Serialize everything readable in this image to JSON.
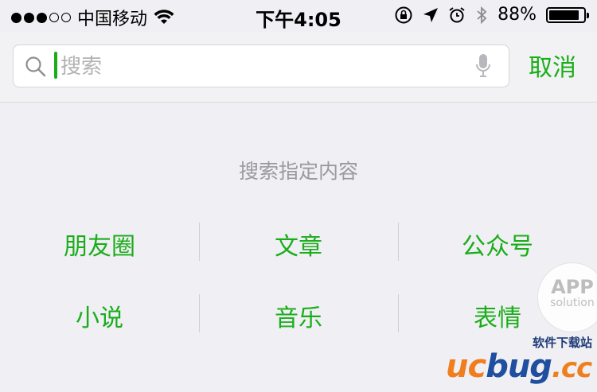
{
  "status_bar": {
    "carrier": "中国移动",
    "time": "下午4:05",
    "battery_text": "88%",
    "battery_level": 0.88,
    "signal_bars_filled": 3,
    "signal_bars_total": 5,
    "icons": [
      "wifi-icon",
      "rotation-lock-icon",
      "location-icon",
      "alarm-icon",
      "bluetooth-icon",
      "battery-icon"
    ]
  },
  "search": {
    "placeholder": "搜索",
    "value": "",
    "cancel_label": "取消",
    "accent_color": "#1aad19"
  },
  "main": {
    "title": "搜索指定内容",
    "categories": [
      [
        "朋友圈",
        "文章",
        "公众号"
      ],
      [
        "小说",
        "音乐",
        "表情"
      ]
    ]
  },
  "watermark": {
    "badge_line1": "APP",
    "badge_line2": "solution",
    "site_text": "软件下载站",
    "logo_part1": "uc",
    "logo_part2": "bug",
    "logo_part3": ".cc"
  }
}
